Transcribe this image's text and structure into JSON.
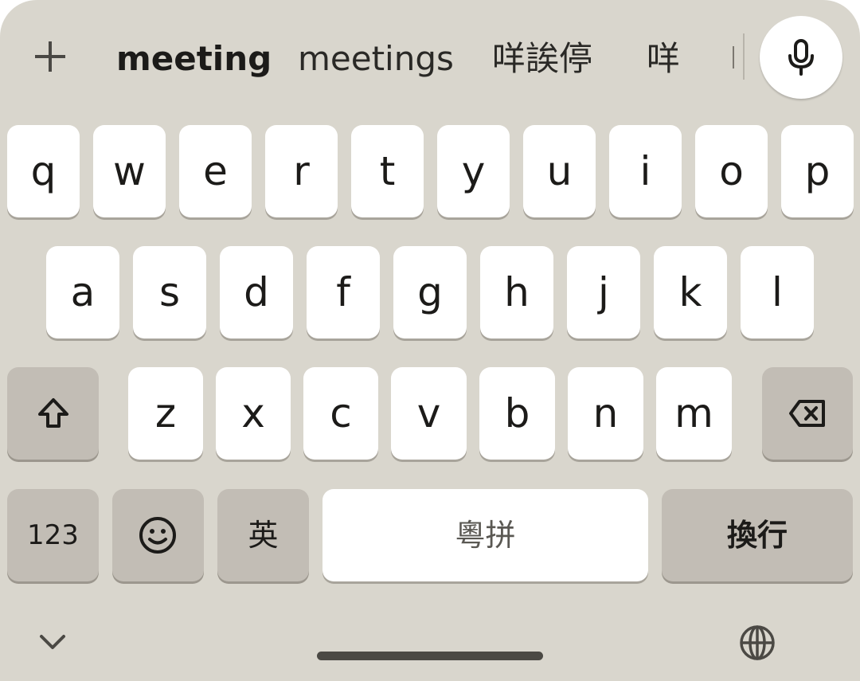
{
  "suggestions": {
    "primary": "meeting",
    "items": [
      "meetings",
      "咩誒停",
      "咩"
    ]
  },
  "rows": {
    "row1": [
      "q",
      "w",
      "e",
      "r",
      "t",
      "y",
      "u",
      "i",
      "o",
      "p"
    ],
    "row2": [
      "a",
      "s",
      "d",
      "f",
      "g",
      "h",
      "j",
      "k",
      "l"
    ],
    "row3": [
      "z",
      "x",
      "c",
      "v",
      "b",
      "n",
      "m"
    ]
  },
  "function_keys": {
    "numbers": "123",
    "language": "英",
    "space": "粵拼",
    "enter": "換行"
  },
  "icons": {
    "plus": "plus-icon",
    "mic": "microphone-icon",
    "shift": "shift-arrow-icon",
    "backspace": "backspace-icon",
    "emoji": "smiley-face-icon",
    "hide": "chevron-down-icon",
    "language_switch": "globe-icon"
  },
  "colors": {
    "keyboard_bg": "#d9d6cd",
    "key": "#ffffff",
    "function_key": "#c2bdb5",
    "text": "#1c1b19"
  }
}
